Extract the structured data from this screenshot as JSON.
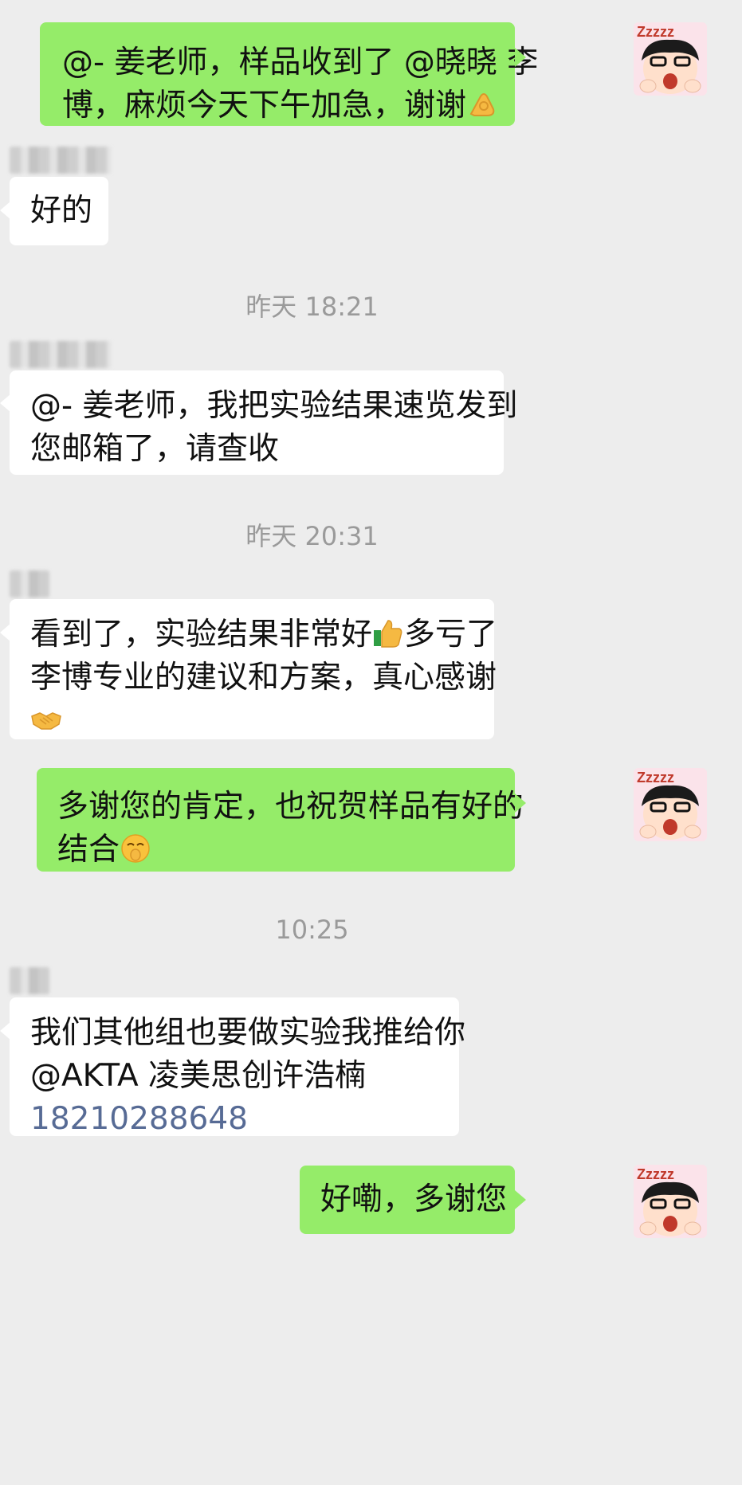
{
  "messages": [
    {
      "side": "right",
      "lines": [
        "@- 姜老师，样品收到了 @晓晓 李",
        "博，麻烦今天下午加急，谢谢"
      ],
      "emoji": "ok-hand-emoji"
    },
    {
      "side": "left",
      "lines": [
        "好的"
      ]
    },
    {
      "time": "昨天 18:21"
    },
    {
      "side": "left",
      "lines": [
        "@- 姜老师，我把实验结果速览发到",
        "您邮箱了，请查收"
      ]
    },
    {
      "time": "昨天 20:31"
    },
    {
      "side": "left",
      "lines": [
        "看到了，实验结果非常好",
        "多亏了",
        "李博专业的建议和方案，真心感谢"
      ]
    },
    {
      "side": "right",
      "lines": [
        "多谢您的肯定，也祝贺样品有好的",
        "结合"
      ]
    },
    {
      "time": "10:25"
    },
    {
      "side": "left",
      "lines": [
        "我们其他组也要做实验我推给你",
        "@AKTA 凌美思创许浩楠"
      ],
      "phone": "18210288648"
    },
    {
      "side": "right",
      "lines": [
        "好嘞，多谢您"
      ]
    }
  ],
  "avatar_text": "Zzzzz",
  "colors": {
    "background": "#ededed",
    "mine_bubble": "#95ec69",
    "their_bubble": "#ffffff",
    "link": "#576b95",
    "timestamp": "#9a9a9a"
  }
}
